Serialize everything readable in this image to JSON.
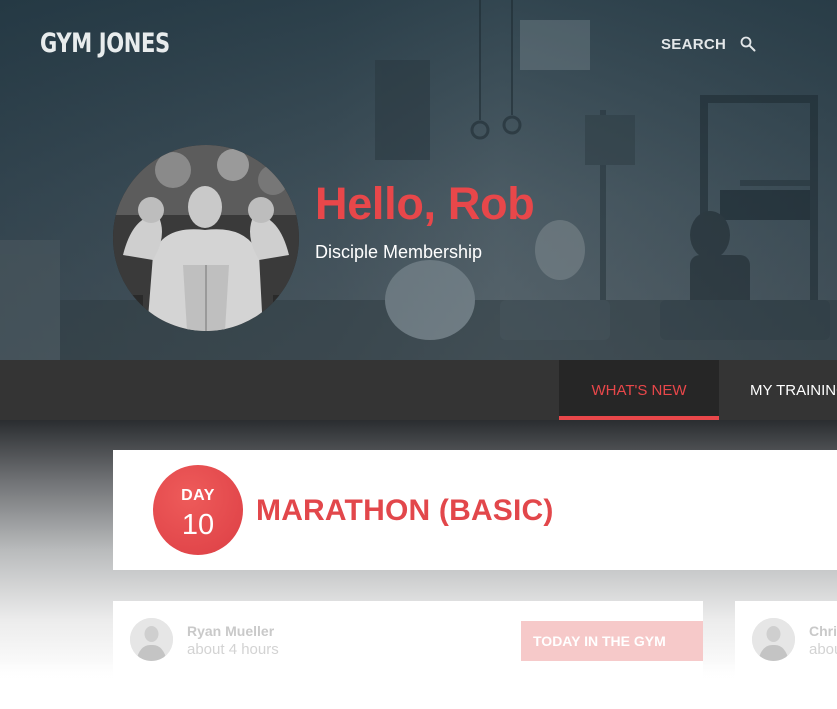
{
  "header": {
    "logo": "GYM JONES",
    "search_label": "SEARCH",
    "search_icon": "search-icon"
  },
  "profile": {
    "greeting": "Hello, Rob",
    "membership": "Disciple Membership",
    "avatar_icon": "profile-photo"
  },
  "nav": {
    "tabs": [
      {
        "label": "WHAT'S NEW",
        "active": true
      },
      {
        "label": "MY TRAINING",
        "active": false
      }
    ]
  },
  "program": {
    "day_label": "DAY",
    "day_number": "10",
    "title": "MARATHON (BASIC)"
  },
  "feed": {
    "posts": [
      {
        "author": "Ryan Mueller",
        "time": "about 4 hours",
        "tag": "TODAY IN THE GYM"
      },
      {
        "author": "Chris",
        "time": "about",
        "tag": ""
      }
    ]
  },
  "colors": {
    "accent": "#e8474a",
    "nav_bg": "#343434",
    "nav_active_bg": "#262626"
  }
}
